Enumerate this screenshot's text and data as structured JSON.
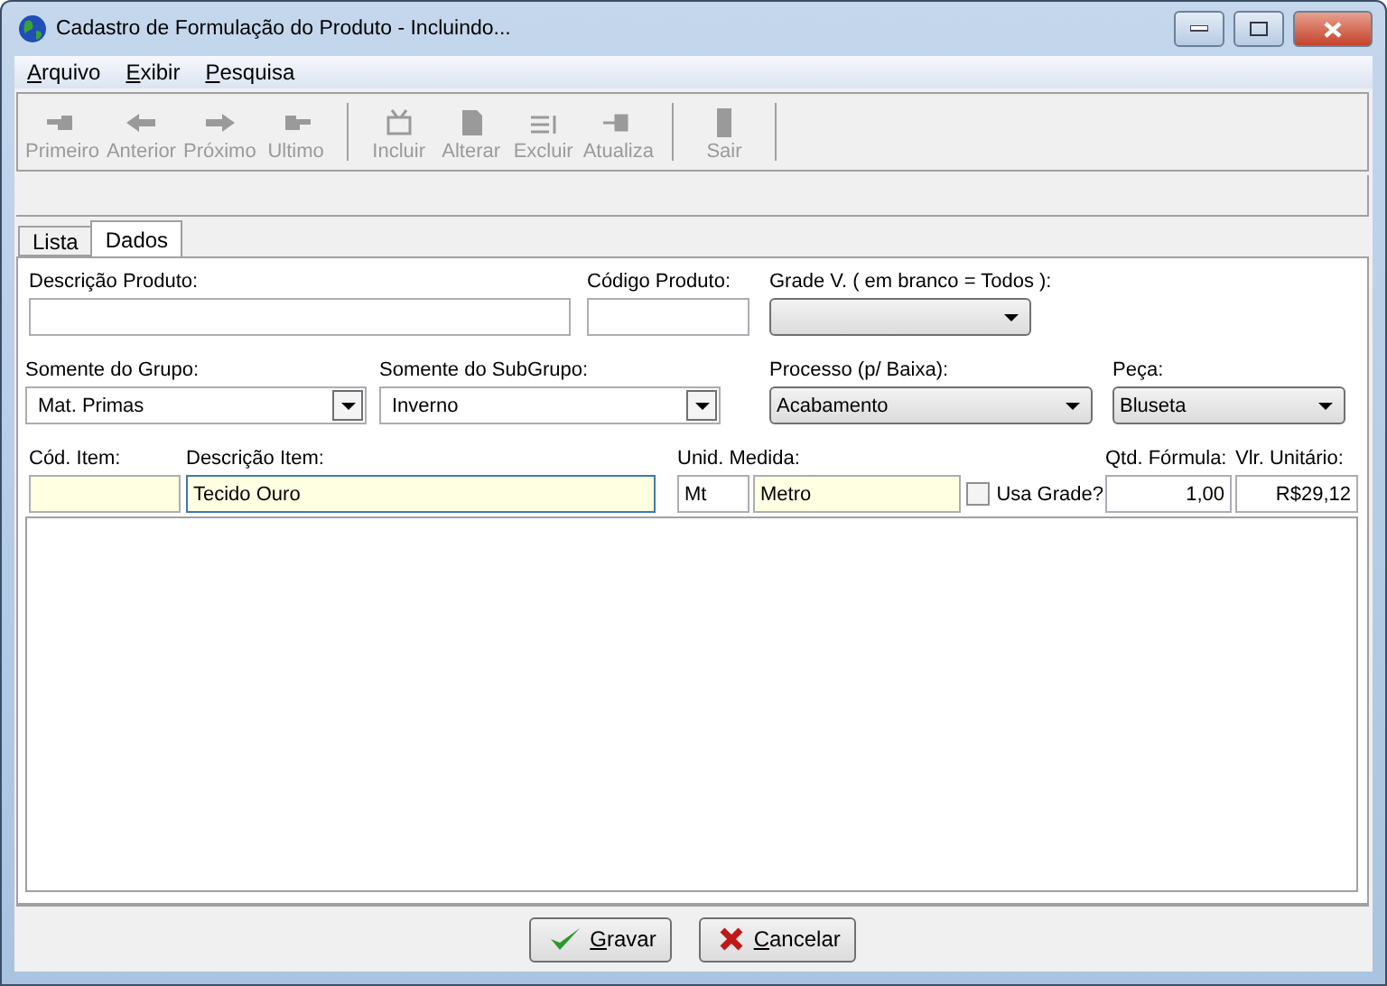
{
  "window": {
    "title": "Cadastro de Formulação do Produto - Incluindo..."
  },
  "menu": [
    "Arquivo",
    "Exibir",
    "Pesquisa"
  ],
  "toolbar": [
    {
      "label": "Primeiro",
      "kind": "first",
      "disabled": true
    },
    {
      "label": "Anterior",
      "kind": "prev",
      "disabled": true
    },
    {
      "label": "Próximo",
      "kind": "next",
      "disabled": true
    },
    {
      "label": "Ultimo",
      "kind": "last",
      "disabled": true
    },
    {
      "kind": "separator"
    },
    {
      "label": "Incluir",
      "kind": "add",
      "disabled": true
    },
    {
      "label": "Alterar",
      "kind": "edit",
      "disabled": true
    },
    {
      "label": "Excluir",
      "kind": "delete",
      "disabled": true
    },
    {
      "label": "Atualiza",
      "kind": "refresh",
      "disabled": true
    },
    {
      "kind": "separator"
    },
    {
      "label": "Sair",
      "kind": "exit",
      "disabled": true
    },
    {
      "kind": "separator"
    }
  ],
  "tabs": [
    {
      "label": "Lista",
      "selected": false
    },
    {
      "label": "Dados",
      "selected": true
    }
  ],
  "rows": [
    [
      {
        "kind": "text",
        "label": "Descrição Produto:"
      },
      {
        "kind": "text",
        "label": "Código Produto:"
      },
      {
        "kind": "combo",
        "label": "Grade V. ( em branco = Todos ):"
      }
    ],
    [
      {
        "kind": "combo",
        "label": "Somente do Grupo:",
        "value": "Mat. Primas"
      },
      {
        "kind": "combo",
        "label": "Somente do SubGrupo:",
        "value": "Inverno"
      },
      {
        "kind": "combo",
        "label": "Processo (p/ Baixa):",
        "value": "Acabamento"
      },
      {
        "kind": "combo",
        "label": "Peça:",
        "value": "Bluseta"
      }
    ],
    [
      {
        "kind": "text",
        "label": "Cód. Item:",
        "highlight": true
      },
      {
        "kind": "text",
        "label": "Descrição Item:",
        "value": "Tecido Ouro",
        "highlight": true,
        "focused": true
      },
      {
        "kind": "text",
        "label": "Unid. Medida:",
        "value": "Mt",
        "highlight": false
      },
      {
        "kind": "text",
        "value": "Metro",
        "highlight": true
      },
      {
        "kind": "checkbox",
        "label": "Usa Grade?",
        "checked": false
      },
      {
        "kind": "text",
        "label": "Qtd. Fórmula:",
        "value": "1,00",
        "highlight": false
      },
      {
        "kind": "text",
        "label": "Vlr. Unitário:",
        "value": "R$29,12",
        "highlight": false
      }
    ]
  ],
  "buttons": [
    {
      "label": "Gravar",
      "kind": "save"
    },
    {
      "label": "Cancelar",
      "kind": "cancel"
    }
  ]
}
